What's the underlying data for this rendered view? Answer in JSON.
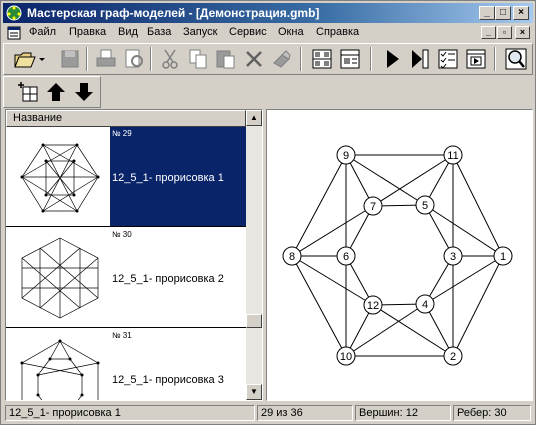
{
  "window": {
    "title": "Мастерская граф-моделей - [Демонстрация.gmb]",
    "minimize": "_",
    "maximize": "□",
    "close": "×"
  },
  "menu": {
    "items": [
      {
        "label": "Файл"
      },
      {
        "label": "Правка"
      },
      {
        "label": "Вид"
      },
      {
        "label": "База"
      },
      {
        "label": "Запуск"
      },
      {
        "label": "Сервис"
      },
      {
        "label": "Окна"
      },
      {
        "label": "Справка"
      }
    ],
    "mdi_minimize": "_",
    "mdi_restore": "▫",
    "mdi_close": "×"
  },
  "toolbar_main": {
    "icons": [
      "open-icon",
      "save-icon",
      "print-icon",
      "print-preview-icon",
      "cut-icon",
      "copy-icon",
      "paste-icon",
      "delete-icon",
      "eraser-icon",
      "layout-grid-icon",
      "layout-detail-icon",
      "run-icon",
      "step-icon",
      "checklist-icon",
      "play-window-icon",
      "zoom-icon"
    ]
  },
  "toolbar_secondary": {
    "icons": [
      "add-graph-icon",
      "move-up-icon",
      "move-down-icon"
    ]
  },
  "list": {
    "column_header": "Название",
    "items": [
      {
        "number": "№ 29",
        "label": "12_5_1- прорисовка 1",
        "selected": true
      },
      {
        "number": "№ 30",
        "label": "12_5_1- прорисовка 2",
        "selected": false
      },
      {
        "number": "№ 31",
        "label": "12_5_1- прорисовка 3",
        "selected": false
      }
    ]
  },
  "graph": {
    "vertices": [
      "1",
      "2",
      "3",
      "4",
      "5",
      "6",
      "7",
      "8",
      "9",
      "10",
      "11",
      "12"
    ]
  },
  "status": {
    "name": "12_5_1- прорисовка 1",
    "position": "29 из 36",
    "vertices": "Вершин: 12",
    "edges": "Ребер: 30"
  },
  "colors": {
    "title_active": "#0a246a",
    "selection": "#0a246a",
    "face": "#d4d0c8"
  }
}
